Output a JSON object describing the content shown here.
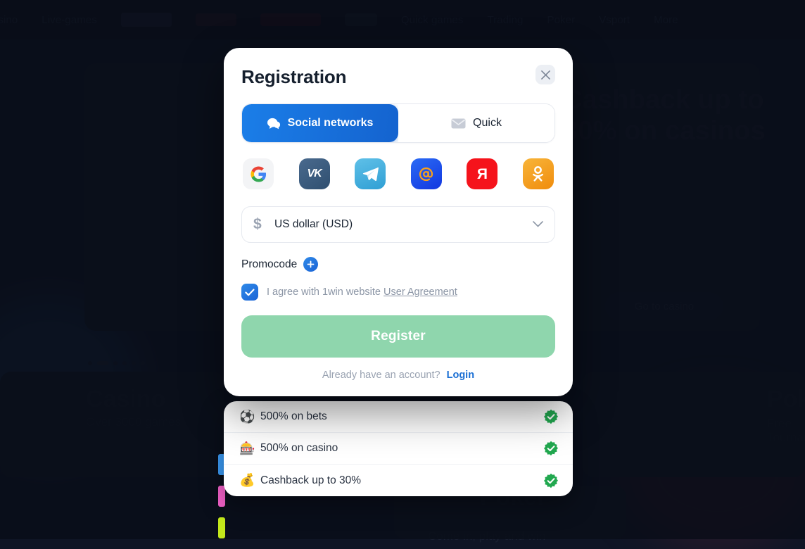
{
  "background": {
    "nav_items": [
      "Casino",
      "Live-games",
      "Quick games",
      "Trading",
      "Poker",
      "Vsport",
      "More"
    ],
    "banner_headline": "Cashback up to 30% on casinos",
    "banner_button": "Go to casino",
    "tile_casino_title": "Casino",
    "tile_casino_sub": "Over 3000 games",
    "tile_poker_title": "Poker",
    "tile_poker_sub": "Come in, play and win",
    "tile_poker_right_title": "Poker",
    "tile_poker_right_sub": "Free Tournaments"
  },
  "modal": {
    "title": "Registration",
    "close_label": "Close",
    "tabs": [
      {
        "label": "Social networks",
        "icon": "chat-bubble-icon",
        "active": true
      },
      {
        "label": "Quick",
        "icon": "envelope-icon",
        "active": false
      }
    ],
    "socials": [
      {
        "name": "google",
        "glyph": "G",
        "bg": "#f3f4f6",
        "fg": "#4285f4"
      },
      {
        "name": "vk",
        "glyph": "VK",
        "bg": "#3a587a",
        "fg": "#ffffff"
      },
      {
        "name": "telegram",
        "glyph": "➤",
        "bg": "#3fa9dd",
        "fg": "#ffffff"
      },
      {
        "name": "mailru",
        "glyph": "@",
        "bg": "#1b4ff0",
        "fg": "#f8a01c"
      },
      {
        "name": "yandex",
        "glyph": "Я",
        "bg": "#f5131b",
        "fg": "#ffffff"
      },
      {
        "name": "odnoklassniki",
        "glyph": "OK",
        "bg": "#f5a11d",
        "fg": "#ffffff"
      }
    ],
    "currency": {
      "symbol": "$",
      "label": "US dollar  (USD)",
      "chevron": "chevron-down-icon"
    },
    "promocode": {
      "label": "Promocode",
      "add_label": "+"
    },
    "agreement": {
      "checked": true,
      "text_before": "I agree with 1win website",
      "link_text": "User Agreement"
    },
    "register_button": "Register",
    "login_prompt": "Already have an account?",
    "login_link": "Login"
  },
  "bonuses": [
    {
      "icon": "soccer-ball-icon",
      "text": "500% on bets",
      "accent": "#3b9bf5",
      "checked": true
    },
    {
      "icon": "slot-machine-icon",
      "text": "500% on casino",
      "accent": "#f261c8",
      "checked": true
    },
    {
      "icon": "cashback-coin-icon",
      "text": "Cashback up to 30%",
      "accent": "#c3e81b",
      "checked": true
    }
  ],
  "colors": {
    "page_background": "#111829",
    "modal_background": "#ffffff",
    "tab_active": "#1463cf",
    "accent_blue": "#1a6fd4",
    "register_button": "#8fd6ad",
    "check_badge_green": "#21a84f"
  }
}
